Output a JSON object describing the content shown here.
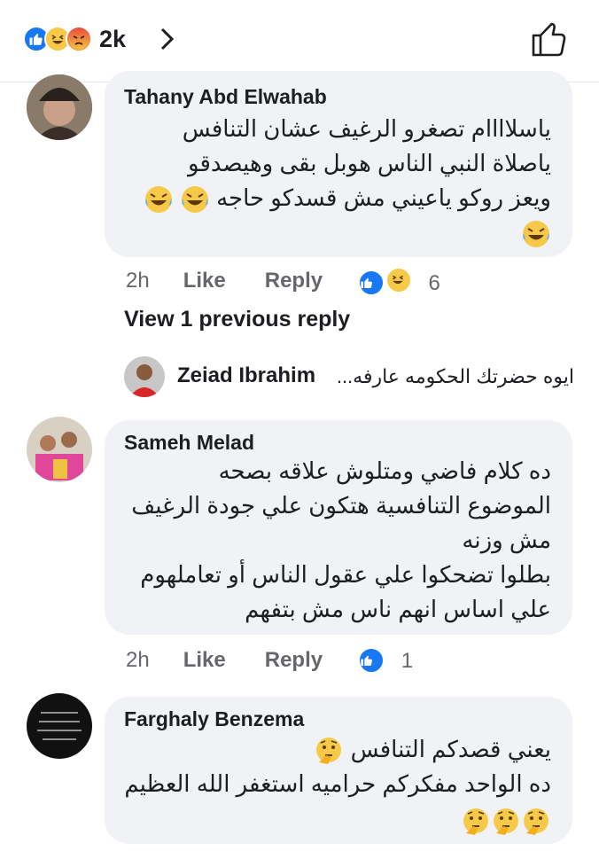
{
  "header": {
    "reaction_icons": [
      "like-icon",
      "haha-icon",
      "angry-icon"
    ],
    "reaction_count": "2k"
  },
  "comments": [
    {
      "author": "Tahany Abd Elwahab",
      "lines": [
        "ياسلاااام تصغرو الرغيف عشان التنافس",
        "ياصلاة النبي الناس هوبل بقى وهيصدقو",
        "ويعز روكو ياعيني مش قسدكو حاجه"
      ],
      "time": "2h",
      "like": "Like",
      "reply": "Reply",
      "reaction_icons": [
        "like-icon",
        "haha-icon"
      ],
      "reaction_count": "6"
    },
    {
      "author": "Sameh Melad",
      "lines": [
        "ده كلام فاضي ومتلوش علاقه بصحه",
        "الموضوع التنافسية هتكون علي جودة الرغيف",
        "مش وزنه",
        "بطلوا تضحكوا علي عقول الناس أو تعاملهوم",
        "علي اساس انهم ناس مش بتفهم"
      ],
      "time": "2h",
      "like": "Like",
      "reply": "Reply",
      "reaction_icons": [
        "like-icon"
      ],
      "reaction_count": "1"
    },
    {
      "author": "Farghaly Benzema",
      "lines": [
        "يعني قصدكم التنافس",
        "ده الواحد مفكركم حراميه استغفر الله العظيم"
      ]
    }
  ],
  "view_previous": "View 1 previous reply",
  "reply_preview": {
    "author": "Zeiad Ibrahim",
    "text": "ايوه حضرتك الحكومه عارفه..."
  },
  "colors": {
    "accent": "#1877f2",
    "bubble": "#f0f2f5",
    "meta": "#65676b"
  }
}
